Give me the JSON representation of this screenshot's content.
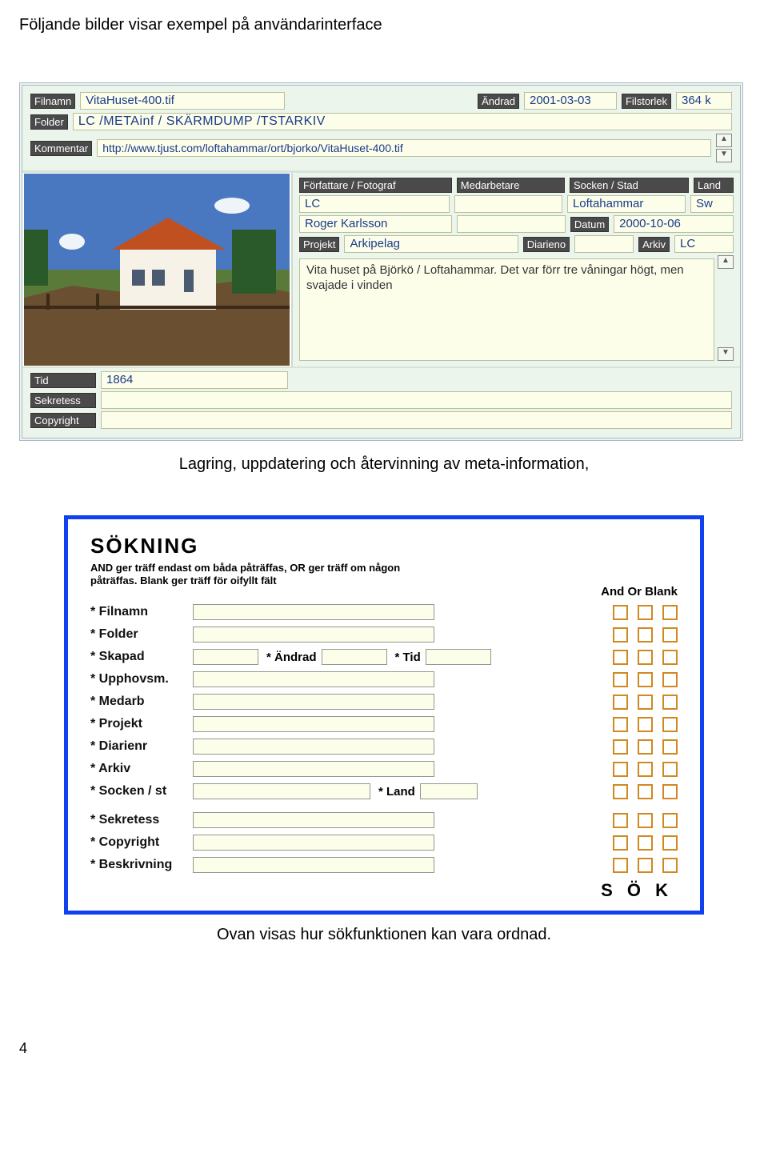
{
  "intro_text": "Följande bilder visar exempel på användarinterface",
  "panel1": {
    "labels": {
      "filnamn": "Filnamn",
      "andrad": "Ändrad",
      "filstorlek": "Filstorlek",
      "folder": "Folder",
      "kommentar": "Kommentar",
      "forfattare": "Författare / Fotograf",
      "medarbetare": "Medarbetare",
      "socken": "Socken / Stad",
      "land": "Land",
      "datum": "Datum",
      "projekt": "Projekt",
      "diarieno": "Diarieno",
      "arkiv": "Arkiv",
      "tid": "Tid",
      "sekretess": "Sekretess",
      "copyright": "Copyright"
    },
    "values": {
      "filnamn": "VitaHuset-400.tif",
      "andrad": "2001-03-03",
      "filstorlek": "364 k",
      "folder": "LC /METAinf / SKÄRMDUMP /TSTARKIV",
      "kommentar": "http://www.tjust.com/loftahammar/ort/bjorko/VitaHuset-400.tif",
      "forfattare1": "LC",
      "forfattare2": "Roger Karlsson",
      "socken": "Loftahammar",
      "land": "Sw",
      "datum": "2000-10-06",
      "projekt": "Arkipelag",
      "arkiv": "LC",
      "description": "Vita huset på Björkö / Loftahammar. Det var förr tre våningar högt, men svajade i vinden",
      "tid": "1864"
    }
  },
  "caption1": "Lagring, uppdatering och återvinning av meta-information,",
  "panel2": {
    "title": "SÖKNING",
    "subtitle": "AND ger träff endast om båda påträffas, OR ger träff om någon påträffas. Blank ger träff för oifyllt fält",
    "header": "And Or Blank",
    "rows": [
      "* Filnamn",
      "* Folder",
      "* Skapad",
      "* Upphovsm.",
      "* Medarb",
      "* Projekt",
      "* Diarienr",
      "* Arkiv",
      "* Socken / st",
      "* Sekretess",
      "* Copyright",
      "* Beskrivning"
    ],
    "inline": {
      "andrad": "* Ändrad",
      "tid": "* Tid",
      "land": "* Land"
    },
    "sok_button": "S Ö K"
  },
  "caption2": "Ovan visas hur sökfunktionen kan vara ordnad.",
  "page_number": "4"
}
